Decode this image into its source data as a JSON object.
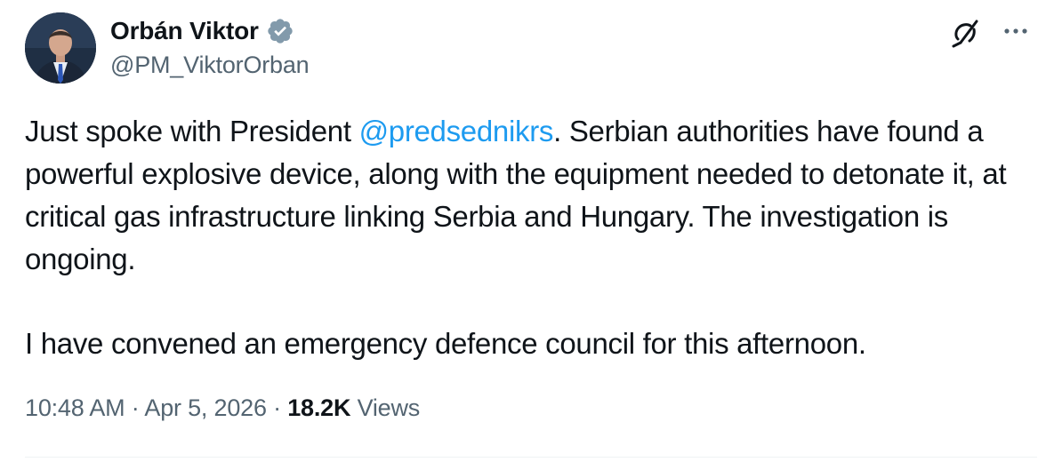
{
  "author": {
    "display_name": "Orbán Viktor",
    "handle": "@PM_ViktorOrban",
    "verified": true,
    "verified_color": "#829aab",
    "avatar_icon": "profile-photo"
  },
  "actions": {
    "grok_icon": "grok-icon",
    "more_icon": "more-icon"
  },
  "post": {
    "line1_before": "Just spoke with President ",
    "mention": "@predsednikrs",
    "line1_after": ". Serbian authorities have found a powerful explosive device, along with the equipment needed to detonate it, at critical gas infrastructure linking Serbia and Hungary. The investigation is ongoing.",
    "paragraph2": "I have convened an emergency defence council for this afternoon."
  },
  "meta": {
    "time": "10:48 AM",
    "separator": " · ",
    "date": "Apr 5, 2026",
    "views_count": "18.2K",
    "views_label": " Views"
  },
  "colors": {
    "text": "#0f1419",
    "secondary": "#536471",
    "link": "#1d9bf0",
    "divider": "#eff3f4"
  }
}
